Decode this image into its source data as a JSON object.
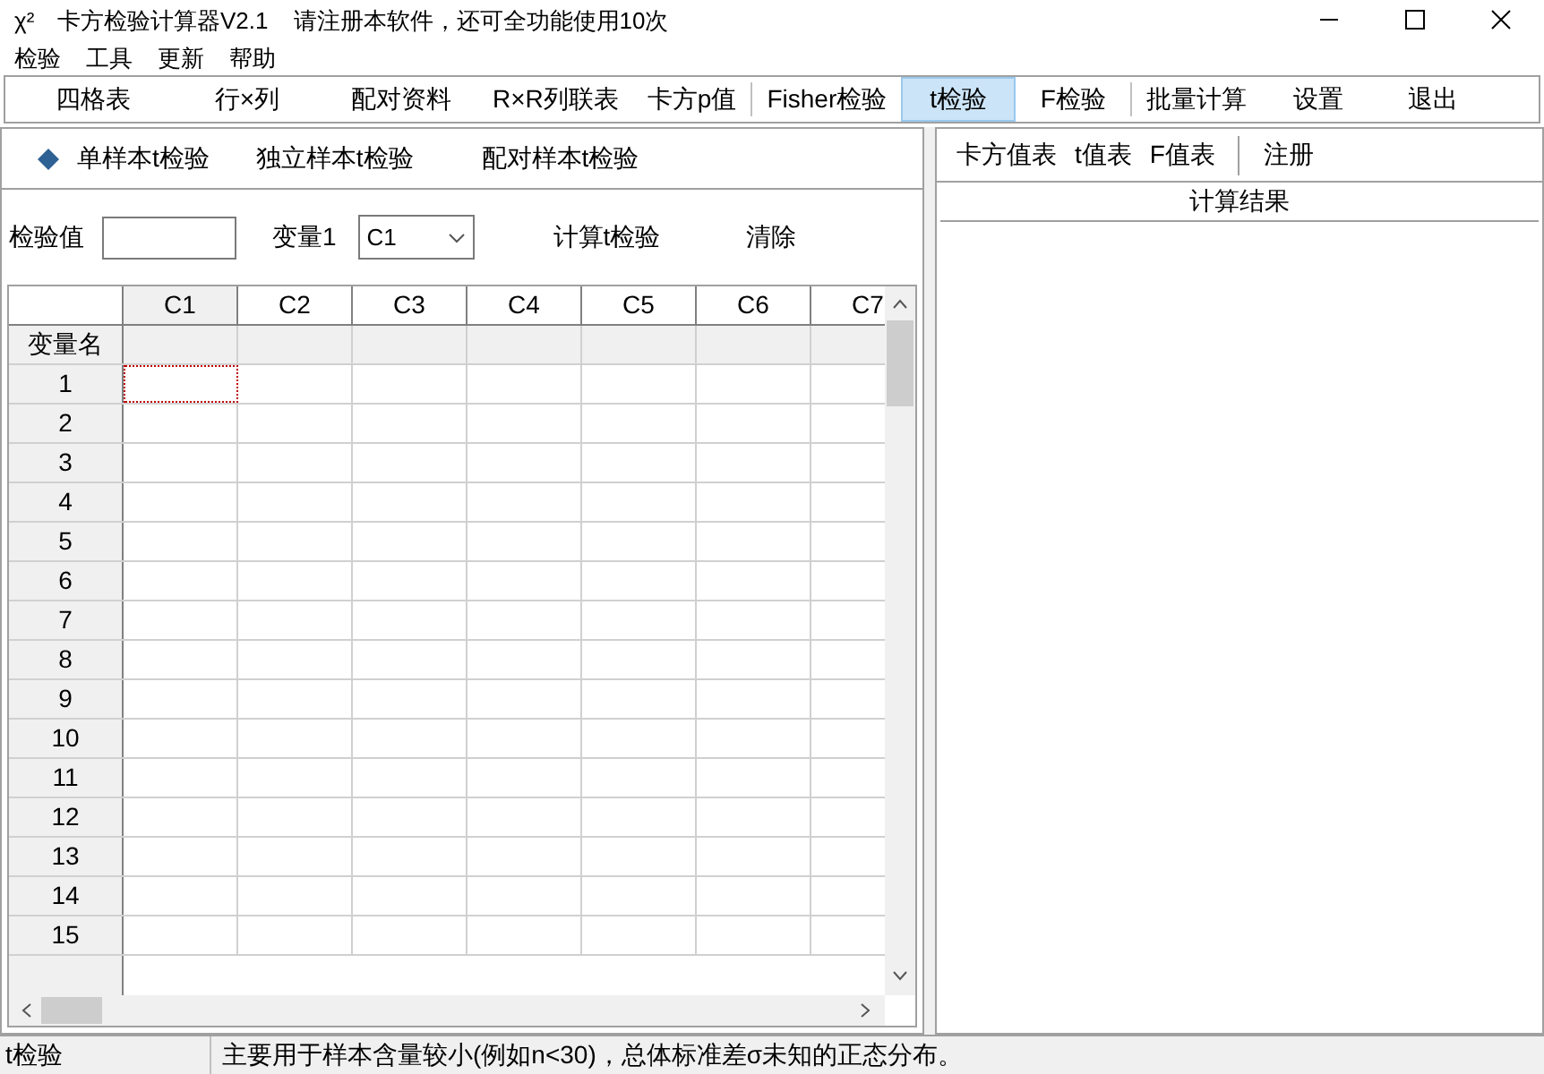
{
  "window": {
    "icon": "χ²",
    "title": "卡方检验计算器V2.1",
    "notice": "请注册本软件，还可全功能使用10次"
  },
  "menu": [
    "检验",
    "工具",
    "更新",
    "帮助"
  ],
  "toolbar": [
    {
      "label": "四格表",
      "selected": false
    },
    {
      "label": "行×列",
      "selected": false
    },
    {
      "label": "配对资料",
      "selected": false
    },
    {
      "label": "R×R列联表",
      "selected": false
    },
    {
      "label": "卡方p值",
      "selected": false,
      "separator_after": true
    },
    {
      "label": "Fisher检验",
      "selected": false
    },
    {
      "label": "t检验",
      "selected": true
    },
    {
      "label": "F检验",
      "selected": false,
      "separator_after": true
    },
    {
      "label": "批量计算",
      "selected": false
    },
    {
      "label": "设置",
      "selected": false
    },
    {
      "label": "退出",
      "selected": false
    }
  ],
  "test_tabs": [
    {
      "label": "单样本t检验",
      "selected": true
    },
    {
      "label": "独立样本t检验",
      "selected": false
    },
    {
      "label": "配对样本t检验",
      "selected": false
    }
  ],
  "form": {
    "test_value_label": "检验值",
    "variable_label": "变量1",
    "variable_value": "C1",
    "compute_button": "计算t检验",
    "clear_button": "清除"
  },
  "table": {
    "columns": [
      {
        "label": "C1",
        "selected": true
      },
      {
        "label": "C2",
        "selected": false
      },
      {
        "label": "C3",
        "selected": false
      },
      {
        "label": "C4",
        "selected": false
      },
      {
        "label": "C5",
        "selected": false
      },
      {
        "label": "C6",
        "selected": false
      },
      {
        "label": "C7",
        "selected": false
      }
    ],
    "name_row": "变量名",
    "rows": [
      "1",
      "2",
      "3",
      "4",
      "5",
      "6",
      "7",
      "8",
      "9",
      "10",
      "11",
      "12",
      "13",
      "14",
      "15"
    ]
  },
  "right_toolbar": [
    {
      "label": "卡方值表",
      "separator_after": false
    },
    {
      "label": "t值表",
      "separator_after": false
    },
    {
      "label": "F值表",
      "separator_after": true
    },
    {
      "label": "注册",
      "separator_after": false
    }
  ],
  "results_title": "计算结果",
  "status_bar": {
    "mode": "t检验",
    "message": "主要用于样本含量较小(例如n<30)，总体标准差σ未知的正态分布。"
  }
}
